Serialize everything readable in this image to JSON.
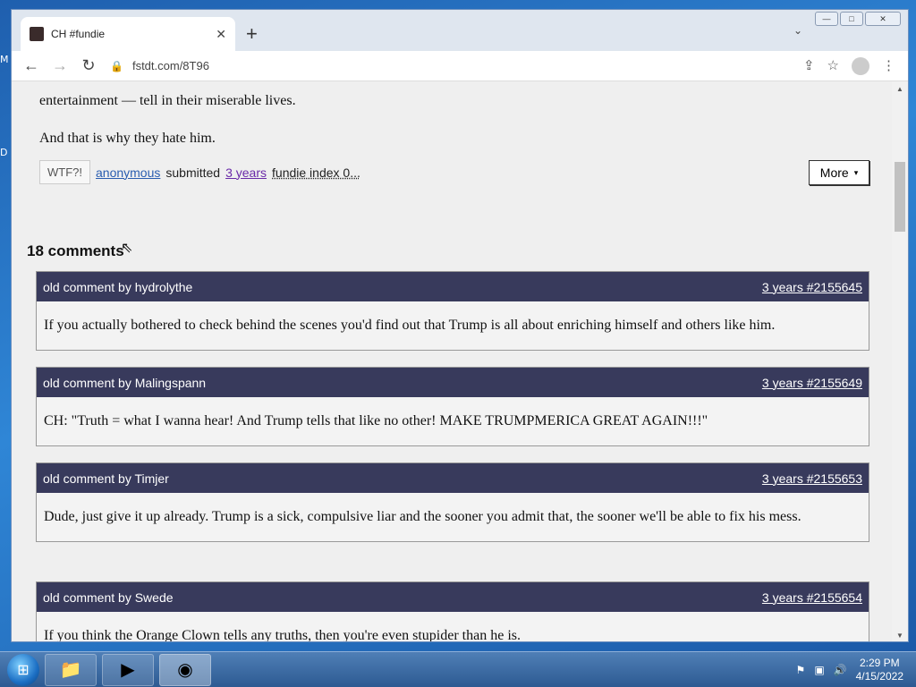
{
  "desktop": {
    "icon_labels": [
      "M",
      "D"
    ]
  },
  "browser": {
    "tab_title": "CH #fundie",
    "tab_close": "✕",
    "new_tab": "+",
    "url": "fstdt.com/8T96",
    "window_controls": {
      "minimize": "—",
      "maximize": "□",
      "close": "✕"
    }
  },
  "post": {
    "text_line_1": "entertainment — tell in their miserable lives.",
    "text_line_2": "And that is why they hate him.",
    "wtf_label": "WTF?!",
    "author": "anonymous",
    "submitted_label": "submitted",
    "time_ago": "3 years",
    "fundie_index": "fundie index 0...",
    "more_label": "More",
    "more_caret": "▾"
  },
  "comments_heading": "18 comments",
  "comments": [
    {
      "header": "old comment by hydrolythe",
      "link": "3 years #2155645",
      "body": "If you actually bothered to check behind the scenes you'd find out that Trump is all about enriching himself and others like him."
    },
    {
      "header": "old comment by Malingspann",
      "link": "3 years #2155649",
      "body": "CH: \"Truth = what I wanna hear! And Trump tells that like no other! MAKE TRUMPMERICA GREAT AGAIN!!!\""
    },
    {
      "header": "old comment by Timjer",
      "link": "3 years #2155653",
      "body": "Dude, just give it up already. Trump is a sick, compulsive liar and the sooner you admit that, the sooner we'll be able to fix his mess."
    },
    {
      "header": "old comment by Swede",
      "link": "3 years #2155654",
      "body": "If you think the Orange Clown tells any truths, then you're even stupider than he is."
    }
  ],
  "taskbar": {
    "time": "2:29 PM",
    "date": "4/15/2022"
  }
}
